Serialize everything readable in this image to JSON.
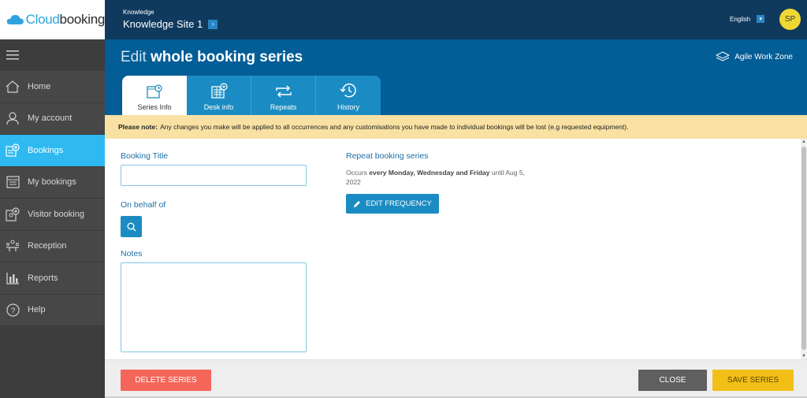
{
  "brand": {
    "logo_prefix": "Cloud",
    "logo_suffix": "booking"
  },
  "sidebar": {
    "items": [
      {
        "label": "Home",
        "icon": "home-icon"
      },
      {
        "label": "My account",
        "icon": "user-icon"
      },
      {
        "label": "Bookings",
        "icon": "bookings-icon",
        "active": true
      },
      {
        "label": "My bookings",
        "icon": "calendar-icon"
      },
      {
        "label": "Visitor booking",
        "icon": "visitor-icon"
      },
      {
        "label": "Reception",
        "icon": "reception-icon"
      },
      {
        "label": "Reports",
        "icon": "reports-icon"
      },
      {
        "label": "Help",
        "icon": "help-icon"
      }
    ]
  },
  "header": {
    "site_small": "Knowledge",
    "site_name": "Knowledge Site 1",
    "language": "English",
    "avatar_initials": "SP"
  },
  "page": {
    "title_prefix": "Edit ",
    "title_bold": "whole booking series",
    "zone": "Agile Work Zone"
  },
  "tabs": [
    {
      "label": "Series Info",
      "active": true
    },
    {
      "label": "Desk info"
    },
    {
      "label": "Repeats"
    },
    {
      "label": "History"
    }
  ],
  "notice": {
    "bold": "Please note:",
    "text": "Any changes you make will be applied to all occurrences and any customisations you have made to individual bookings will be lost (e.g requested equipment)."
  },
  "form": {
    "booking_title_label": "Booking Title",
    "booking_title_value": "",
    "on_behalf_label": "On behalf of",
    "notes_label": "Notes",
    "notes_value": ""
  },
  "repeat": {
    "title": "Repeat booking series",
    "occurs_prefix": "Occurs ",
    "occurs_bold": "every Monday, Wednesday and Friday",
    "occurs_suffix": " until Aug 5, 2022",
    "edit_button": "EDIT FREQUENCY"
  },
  "footer": {
    "delete_label": "DELETE SERIES",
    "close_label": "CLOSE",
    "save_label": "SAVE SERIES"
  },
  "colors": {
    "topbar": "#0f3a5e",
    "titleband": "#035d96",
    "accent": "#1b8cc3",
    "active_nav": "#2ebaf0",
    "notice": "#f8e1a3",
    "delete": "#f4665a",
    "save": "#f2bf17"
  }
}
